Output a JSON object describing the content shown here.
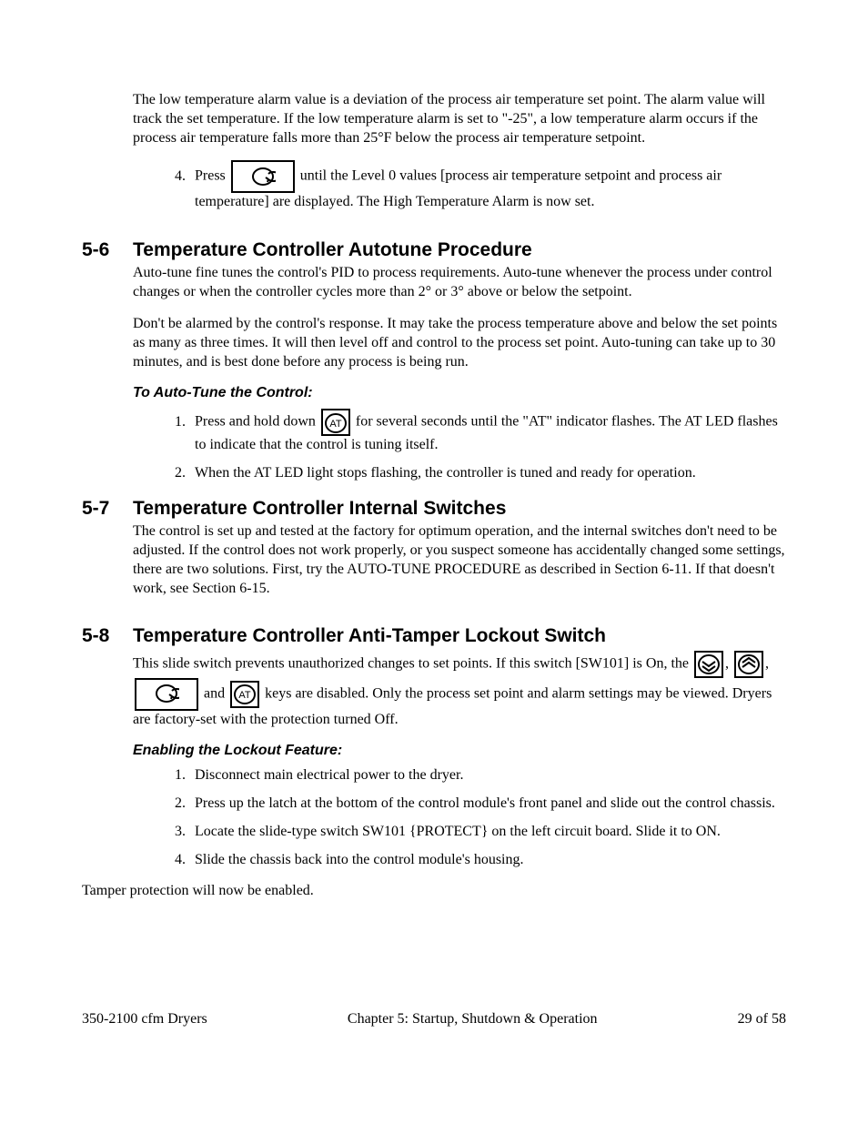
{
  "intro_para": "The low temperature alarm value is a deviation of the process air temperature set point. The alarm value will track the set temperature. If the low temperature alarm is set to \"-25\", a low temperature alarm occurs if the process air temperature falls more than 25°F below the process air temperature setpoint.",
  "step4_a": "Press ",
  "step4_b": " until the Level 0 values [process air temperature setpoint and process air temperature] are displayed. The High Temperature Alarm is now set.",
  "s56_num": "5-6",
  "s56_title": "Temperature Controller Autotune Procedure",
  "s56_p1": "Auto-tune fine tunes the control's PID to process requirements. Auto-tune whenever the process under control changes or when the controller cycles more than 2° or 3° above or below the setpoint.",
  "s56_p2": "Don't be alarmed by the control's response. It may take the process temperature above and below the set points as many as three times. It will then level off and control to the process set point. Auto-tuning can take up to 30 minutes, and is best done before any process is being run.",
  "s56_sub": "To Auto-Tune the Control:",
  "s56_li1_a": "Press and hold down ",
  "s56_li1_b": " for several seconds until the \"AT\" indicator flashes. The AT LED flashes to indicate that the control is tuning itself.",
  "s56_li2": "When the AT LED light stops flashing, the controller is tuned and ready for operation.",
  "s57_num": "5-7",
  "s57_title": "Temperature Controller Internal Switches",
  "s57_p1": "The control is set up and tested at the factory for optimum operation, and the internal switches don't need to be adjusted. If the control does not work properly, or you suspect someone has accidentally changed some settings, there are two solutions. First, try the AUTO-TUNE PROCEDURE as described in Section 6-11. If that doesn't work, see Section 6-15.",
  "s58_num": "5-8",
  "s58_title": "Temperature Controller Anti-Tamper Lockout Switch",
  "s58_p1_a": "This slide switch prevents unauthorized changes to set points. If this switch  [SW101] is On, the ",
  "s58_p1_b": ", ",
  "s58_p1_c": ", ",
  "s58_p1_d": " and  ",
  "s58_p1_e": " keys are disabled. Only the process set point and alarm settings may be viewed. Dryers are factory-set with the protection turned Off.",
  "s58_sub": "Enabling the Lockout Feature:",
  "s58_li1": "Disconnect main electrical power to the dryer.",
  "s58_li2": "Press up the latch at the bottom of the control module's front panel and slide out the control chassis.",
  "s58_li3": "Locate the slide-type switch SW101 {PROTECT} on the left circuit board. Slide it to ON.",
  "s58_li4": "Slide the chassis back into the control module's housing.",
  "s58_closing": "Tamper protection will now be enabled.",
  "footer_left": "350-2100 cfm Dryers",
  "footer_center": "Chapter 5: Startup, Shutdown & Operation",
  "footer_right": "29 of 58",
  "at_label": "AT"
}
